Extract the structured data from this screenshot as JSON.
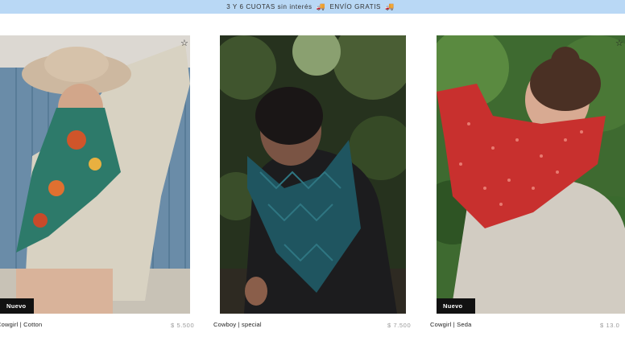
{
  "promo": {
    "cuotas": "3 Y 6 CUOTAS sin interés",
    "envio": "ENVÍO GRATIS",
    "icon": "truck-emoji"
  },
  "products": [
    {
      "name": "Cowgirl | Cotton",
      "price": "$ 5.500",
      "badge": "Nuevo",
      "fav_icon": "star-outline-icon"
    },
    {
      "name": "Cowboy | special",
      "price": "$ 7.500",
      "badge": "",
      "fav_icon": ""
    },
    {
      "name": "Cowgirl | Seda",
      "price": "$ 13.0",
      "badge": "Nuevo",
      "fav_icon": "star-outline-icon"
    }
  ],
  "colors": {
    "promo_bg": "#b9d8f5",
    "badge_bg": "#111111",
    "price_text": "#9a9a9a"
  }
}
